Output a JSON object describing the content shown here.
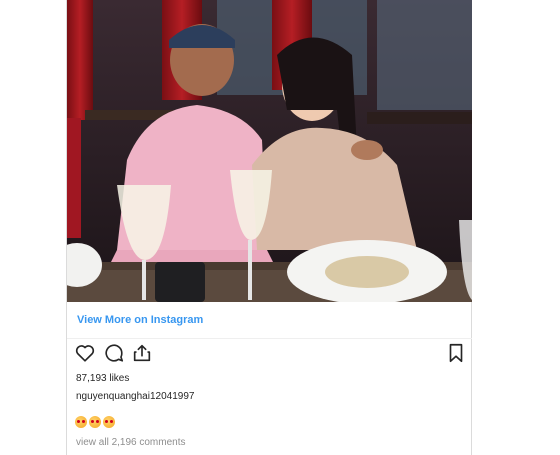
{
  "post": {
    "view_more_label": "View More on Instagram",
    "likes": "87,193 likes",
    "username": "nguyenquanghai12041997",
    "emoji_caption": "🥰🥰🥰",
    "comments_link": "view all 2,196 comments"
  },
  "icons": [
    "heart-icon",
    "comment-icon",
    "share-icon",
    "bookmark-icon"
  ],
  "colors": {
    "link": "#3897f0",
    "text": "#262626",
    "muted": "#8e8e8e"
  }
}
